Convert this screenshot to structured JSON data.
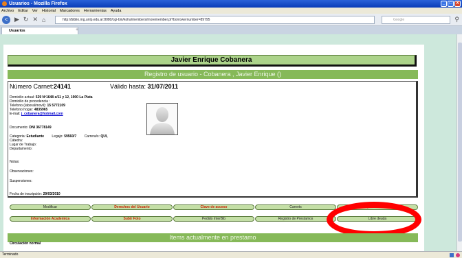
{
  "window": {
    "title": "Usuarios - Mozilla Firefox",
    "btn_min": "_",
    "btn_max": "□",
    "btn_close": "X"
  },
  "menu": [
    "Archivo",
    "Editar",
    "Ver",
    "Historial",
    "Marcadores",
    "Herramientas",
    "Ayuda"
  ],
  "nav": {
    "back": "<",
    "url": "http://biblio.mg.unlp.edu.ar:8080/cgi-bin/koha/members/moremember.pl?borrowernumber=89795",
    "search_placeholder": "Google"
  },
  "tab": {
    "label": "Usuarios",
    "add": "+"
  },
  "patron": {
    "name": "Javier Enrique Cobanera",
    "registro_header": "Registro de usuario - Cobanera , Javier Enrique ()",
    "carnet_label": "Número Carnet:",
    "carnet_value": "24141",
    "valido_label": "Válido hasta: ",
    "valido_value": "31/07/2011",
    "domicilio_label": "Domicilio actual: ",
    "domicilio_value": "529 Nº1648 e/11 y 12, 1900 La Plata",
    "procedencia_label": "Domicilio de procedencia :",
    "tel_celular_label": "Telefono (laboral/movil): ",
    "tel_celular_value": "15 5772109",
    "tel_hogar_label": "Telefono hogar: ",
    "tel_hogar_value": "4835965",
    "email_label": "E-mail: ",
    "email_value": "j_cobanera@hotmail.com",
    "documento_label": "Documento: ",
    "documento_value": "DNI 36778149",
    "categoria_label": "Categoria: ",
    "categoria_value": "Estudiante",
    "legajo_label": "Legajo: ",
    "legajo_value": "59560/7",
    "carrera_label": "Carrera/s: ",
    "carrera_value": "QUI,",
    "catedra_label": "Cátedra:",
    "lugar_label": "Lugar de Trabajo:",
    "departamento_label": "Departamento:",
    "notas_label": "Notas:",
    "observaciones_label": "Observaciones:",
    "suspensiones_label": "Suspensiones:",
    "inscripcion_label": "Fecha de inscripción: ",
    "inscripcion_value": "29/03/2010"
  },
  "buttons_row1": [
    "Modificar",
    "Derechos del Usuario",
    "Clave de acceso",
    "Carnets",
    "Imp. Credenciales"
  ],
  "buttons_row2": [
    "Información Academica",
    "Subir Foto",
    "Pedido InterBib",
    "Registro de Prestamos",
    "Libre deuda"
  ],
  "prestamo_header": "Items actualmente en prestamo",
  "circulacion": "Circulación normal",
  "status": "Terminado"
}
